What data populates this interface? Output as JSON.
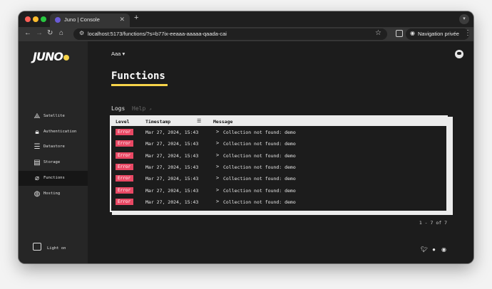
{
  "browser": {
    "tab_title": "Juno | Console",
    "url": "localhost:5173/functions/?s=b77ix-eeaaa-aaaaa-qaada-cai",
    "private_label": "Navigation privée"
  },
  "colors": {
    "accent": "#f7d44a",
    "error_badge": "#e94864",
    "background": "#1c1c1c",
    "sidebar": "#262626"
  },
  "sidebar": {
    "logo_text": "JUNO",
    "items": [
      {
        "label": "Satellite",
        "icon": "satellite-icon"
      },
      {
        "label": "Authentication",
        "icon": "lock-icon"
      },
      {
        "label": "Datastore",
        "icon": "database-icon"
      },
      {
        "label": "Storage",
        "icon": "storage-icon"
      },
      {
        "label": "Functions",
        "icon": "functions-icon"
      },
      {
        "label": "Hosting",
        "icon": "globe-icon"
      }
    ],
    "light_label": "Light on"
  },
  "main": {
    "satellite_select": "Aaa",
    "title": "Functions",
    "tabs": [
      {
        "label": "Logs",
        "active": true
      },
      {
        "label": "Help",
        "active": false
      }
    ],
    "table": {
      "headers": [
        "Level",
        "Timestamp",
        "Message"
      ],
      "rows": [
        {
          "level": "Error",
          "timestamp": "Mar 27, 2024, 15:43",
          "message": "Collection not found: demo"
        },
        {
          "level": "Error",
          "timestamp": "Mar 27, 2024, 15:43",
          "message": "Collection not found: demo"
        },
        {
          "level": "Error",
          "timestamp": "Mar 27, 2024, 15:43",
          "message": "Collection not found: demo"
        },
        {
          "level": "Error",
          "timestamp": "Mar 27, 2024, 15:43",
          "message": "Collection not found: demo"
        },
        {
          "level": "Error",
          "timestamp": "Mar 27, 2024, 15:43",
          "message": "Collection not found: demo"
        },
        {
          "level": "Error",
          "timestamp": "Mar 27, 2024, 15:43",
          "message": "Collection not found: demo"
        },
        {
          "level": "Error",
          "timestamp": "Mar 27, 2024, 15:43",
          "message": "Collection not found: demo"
        }
      ]
    },
    "pagination": "1 - 7 of 7",
    "social": [
      "twitter-icon",
      "github-icon",
      "discord-icon"
    ]
  }
}
